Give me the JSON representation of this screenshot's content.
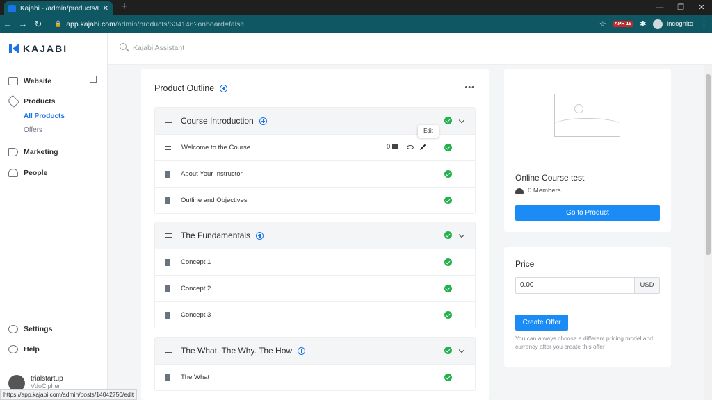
{
  "browser": {
    "tab_title": "Kajabi - /admin/products/634146",
    "new_tab": "+",
    "url_host": "app.kajabi.com",
    "url_path": "/admin/products/634146?onboard=false",
    "incognito_label": "Incognito",
    "ext_badge": "APR 19",
    "status_url": "https://app.kajabi.com/admin/posts/14042750/edit"
  },
  "sidebar": {
    "logo": "KAJABI",
    "items": [
      {
        "label": "Website",
        "icon": "monitor-icon"
      },
      {
        "label": "Products",
        "icon": "tag-icon"
      },
      {
        "label": "Marketing",
        "icon": "megaphone-icon"
      },
      {
        "label": "People",
        "icon": "person-icon"
      }
    ],
    "sub_products": [
      {
        "label": "All Products",
        "active": true
      },
      {
        "label": "Offers",
        "active": false
      }
    ],
    "settings": "Settings",
    "help": "Help",
    "user_name": "trialstartup",
    "user_sub": "VdoCipher"
  },
  "search": {
    "placeholder": "Kajabi Assistant"
  },
  "outline": {
    "title": "Product Outline",
    "more": "•••",
    "edit_tooltip": "Edit",
    "categories": [
      {
        "title": "Course Introduction",
        "posts": [
          {
            "title": "Welcome to the Course",
            "comments": "0"
          },
          {
            "title": "About Your Instructor"
          },
          {
            "title": "Outline and Objectives"
          }
        ]
      },
      {
        "title": "The Fundamentals",
        "posts": [
          {
            "title": "Concept 1"
          },
          {
            "title": "Concept 2"
          },
          {
            "title": "Concept 3"
          }
        ]
      },
      {
        "title": "The What. The Why. The How",
        "posts": [
          {
            "title": "The What"
          }
        ]
      }
    ]
  },
  "product": {
    "title": "Online Course test",
    "members": "0 Members",
    "button": "Go to Product"
  },
  "price": {
    "title": "Price",
    "value": "0.00",
    "currency": "USD",
    "button": "Create Offer",
    "note": "You can always choose a different pricing model and currency after you create this offer"
  },
  "colors": {
    "accent": "#1b8cf5",
    "browser": "#0e5763",
    "success": "#22b14c"
  }
}
